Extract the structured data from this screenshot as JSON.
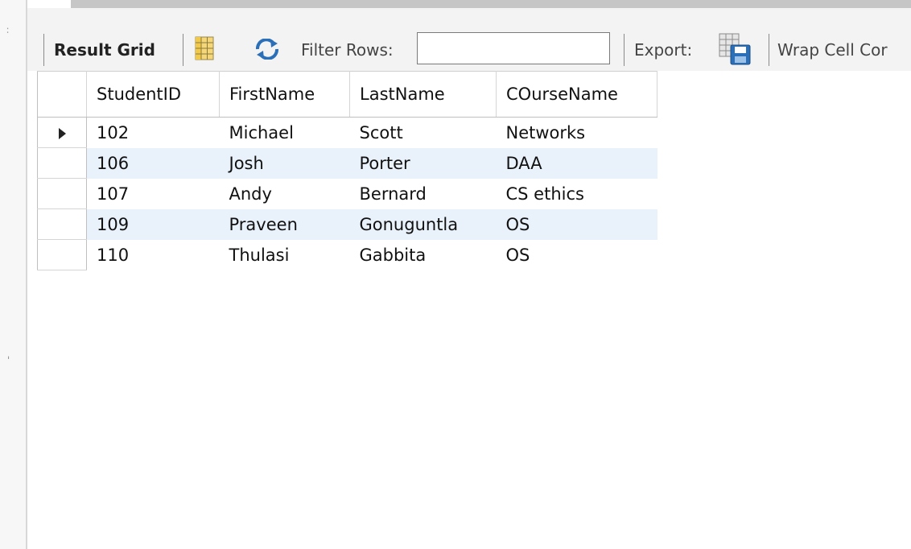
{
  "toolbar": {
    "result_grid_label": "Result Grid",
    "filter_rows_label": "Filter Rows:",
    "filter_rows_value": "",
    "export_label": "Export:",
    "wrap_cell_label": "Wrap Cell Cor"
  },
  "icons": {
    "grid_view": "grid-view-icon",
    "refresh": "refresh-icon",
    "export": "export-icon"
  },
  "colors": {
    "row_stripe": "#e9f1fb",
    "refresh_icon": "#2a6fb8"
  },
  "grid": {
    "columns": [
      "StudentID",
      "FirstName",
      "LastName",
      "COurseName"
    ],
    "selected_row": 0,
    "rows": [
      [
        "102",
        "Michael",
        "Scott",
        "Networks"
      ],
      [
        "106",
        "Josh",
        "Porter",
        "DAA"
      ],
      [
        "107",
        "Andy",
        "Bernard",
        "CS ethics"
      ],
      [
        "109",
        "Praveen",
        "Gonuguntla",
        "OS"
      ],
      [
        "110",
        "Thulasi",
        "Gabbita",
        "OS"
      ]
    ]
  }
}
